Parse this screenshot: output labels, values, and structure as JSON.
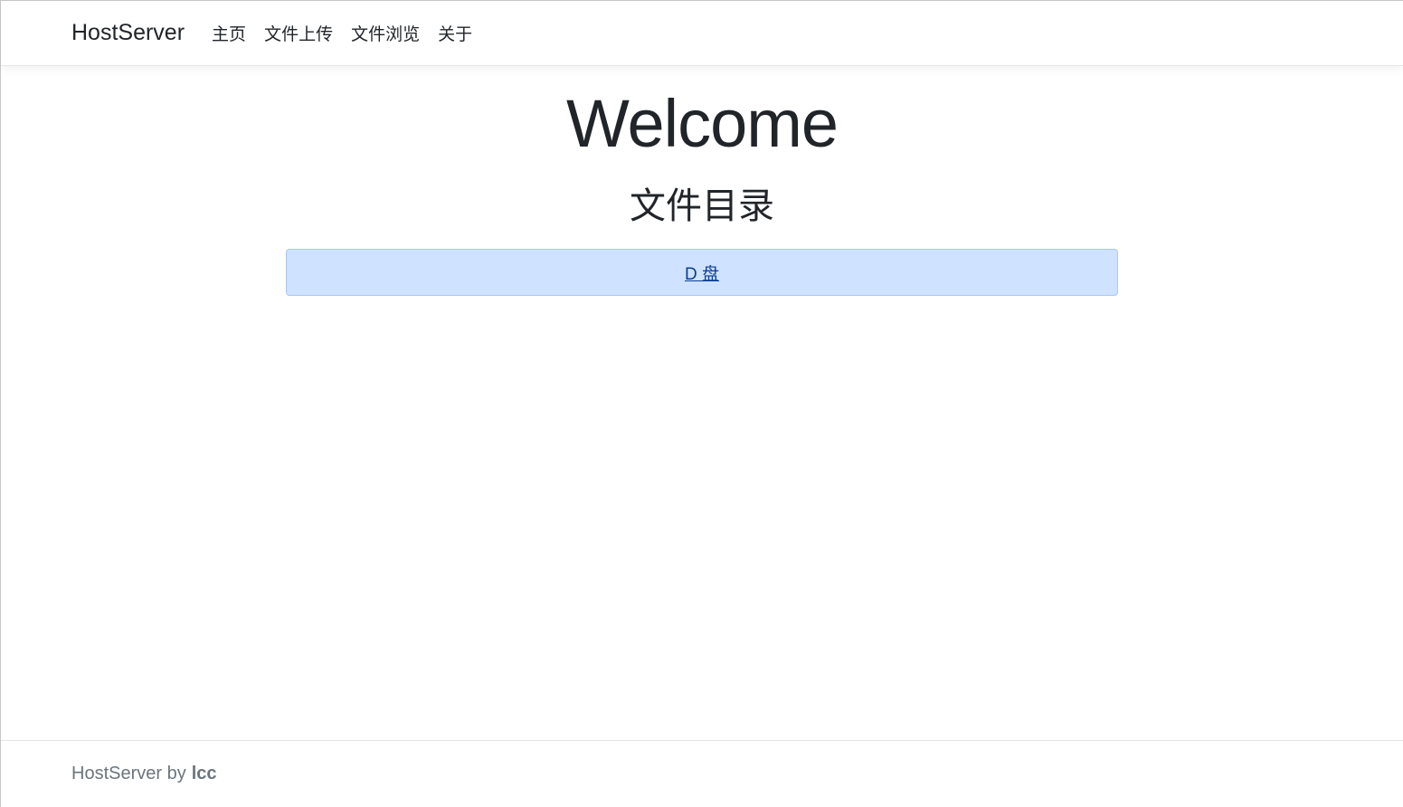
{
  "nav": {
    "brand": "HostServer",
    "items": [
      "主页",
      "文件上传",
      "文件浏览",
      "关于"
    ]
  },
  "main": {
    "title": "Welcome",
    "subtitle": "文件目录",
    "drives": [
      "D 盘"
    ]
  },
  "footer": {
    "text": "HostServer by",
    "author": "lcc"
  }
}
